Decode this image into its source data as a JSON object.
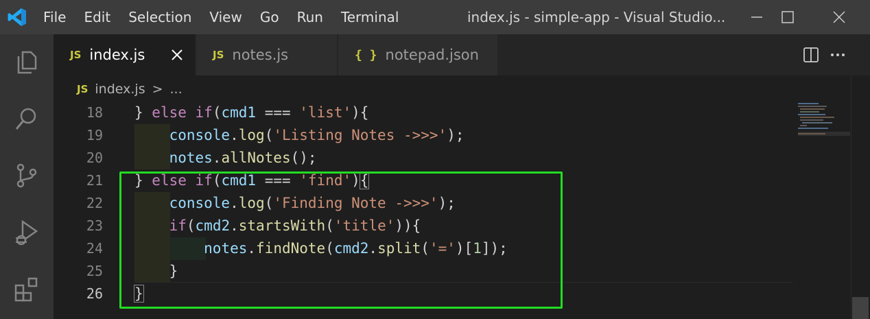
{
  "titlebar": {
    "menu": [
      "File",
      "Edit",
      "Selection",
      "View",
      "Go",
      "Run",
      "Terminal"
    ],
    "window_title": "index.js - simple-app - Visual Studio..."
  },
  "activitybar": {
    "items": [
      "explorer-icon",
      "search-icon",
      "source-control-icon",
      "run-debug-icon",
      "extensions-icon"
    ]
  },
  "tabs": [
    {
      "label": "index.js",
      "icon": "JS",
      "active": true
    },
    {
      "label": "notes.js",
      "icon": "JS",
      "active": false
    },
    {
      "label": "notepad.json",
      "icon": "{ }",
      "active": false
    }
  ],
  "breadcrumb": {
    "icon": "JS",
    "file": "index.js",
    "separator": ">",
    "more": "..."
  },
  "editor": {
    "line_numbers": [
      "18",
      "19",
      "20",
      "21",
      "22",
      "23",
      "24",
      "25",
      "26"
    ],
    "current_line": "26",
    "highlight_color": "#22dd22"
  },
  "colors": {
    "keyword": "#c586c0",
    "variable": "#9cdcfe",
    "string": "#ce9178",
    "function": "#dcdcaa",
    "number": "#b5cea8"
  }
}
